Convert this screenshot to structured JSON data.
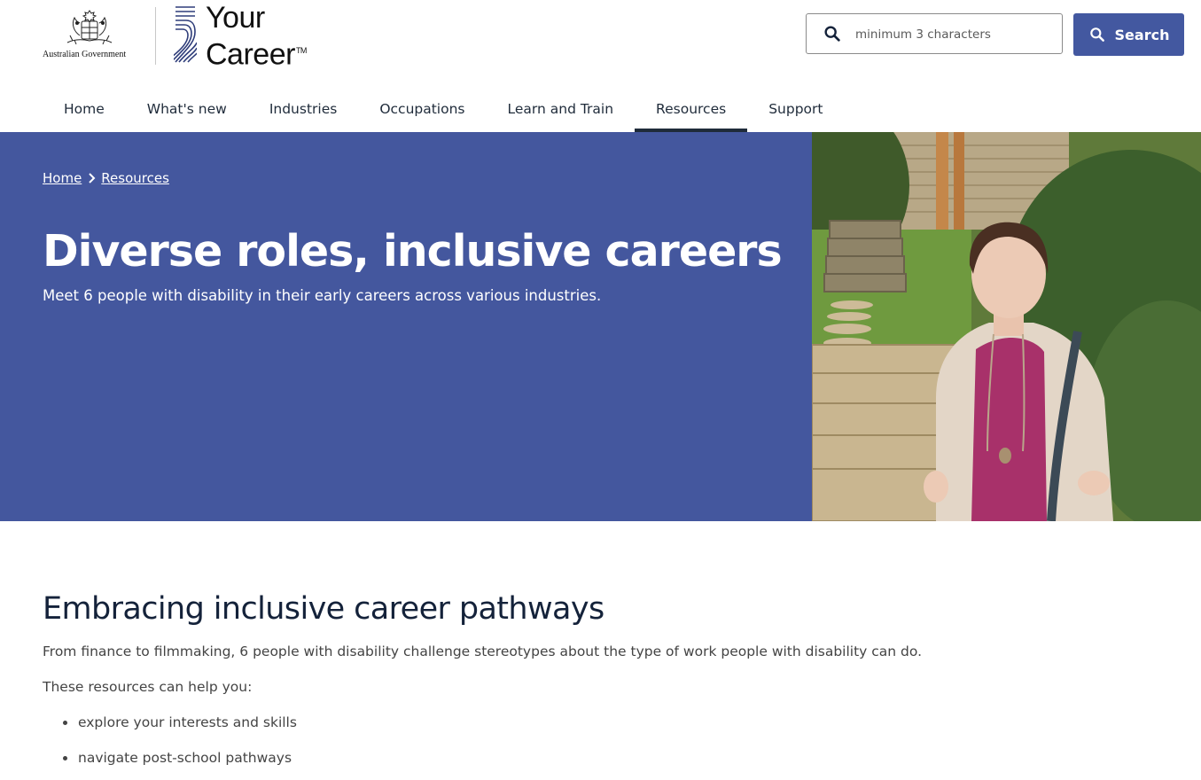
{
  "header": {
    "gov_logo_text": "Australian Government",
    "brand_line1": "Your",
    "brand_line2": "Career",
    "brand_tm": "TM"
  },
  "search": {
    "placeholder": "minimum 3 characters",
    "value": "",
    "button_label": "Search"
  },
  "nav": {
    "items": [
      {
        "label": "Home"
      },
      {
        "label": "What's new"
      },
      {
        "label": "Industries"
      },
      {
        "label": "Occupations"
      },
      {
        "label": "Learn and Train"
      },
      {
        "label": "Resources"
      },
      {
        "label": "Support"
      }
    ],
    "active": "Resources"
  },
  "breadcrumb": {
    "items": [
      "Home",
      "Resources"
    ]
  },
  "hero": {
    "title": "Diverse roles, inclusive careers",
    "subtitle": "Meet 6 people with disability in their early careers across various industries.",
    "background_color": "#44579e"
  },
  "content": {
    "heading": "Embracing inclusive career pathways",
    "intro": "From finance to filmmaking, 6 people with disability challenge stereotypes about the type of work people with disability can do.",
    "lead": "These resources can help you:",
    "bullets": [
      "explore your interests and skills",
      "navigate post-school pathways"
    ]
  },
  "colors": {
    "brand_blue": "#4358a0",
    "text_dark": "#1f2b3a"
  }
}
